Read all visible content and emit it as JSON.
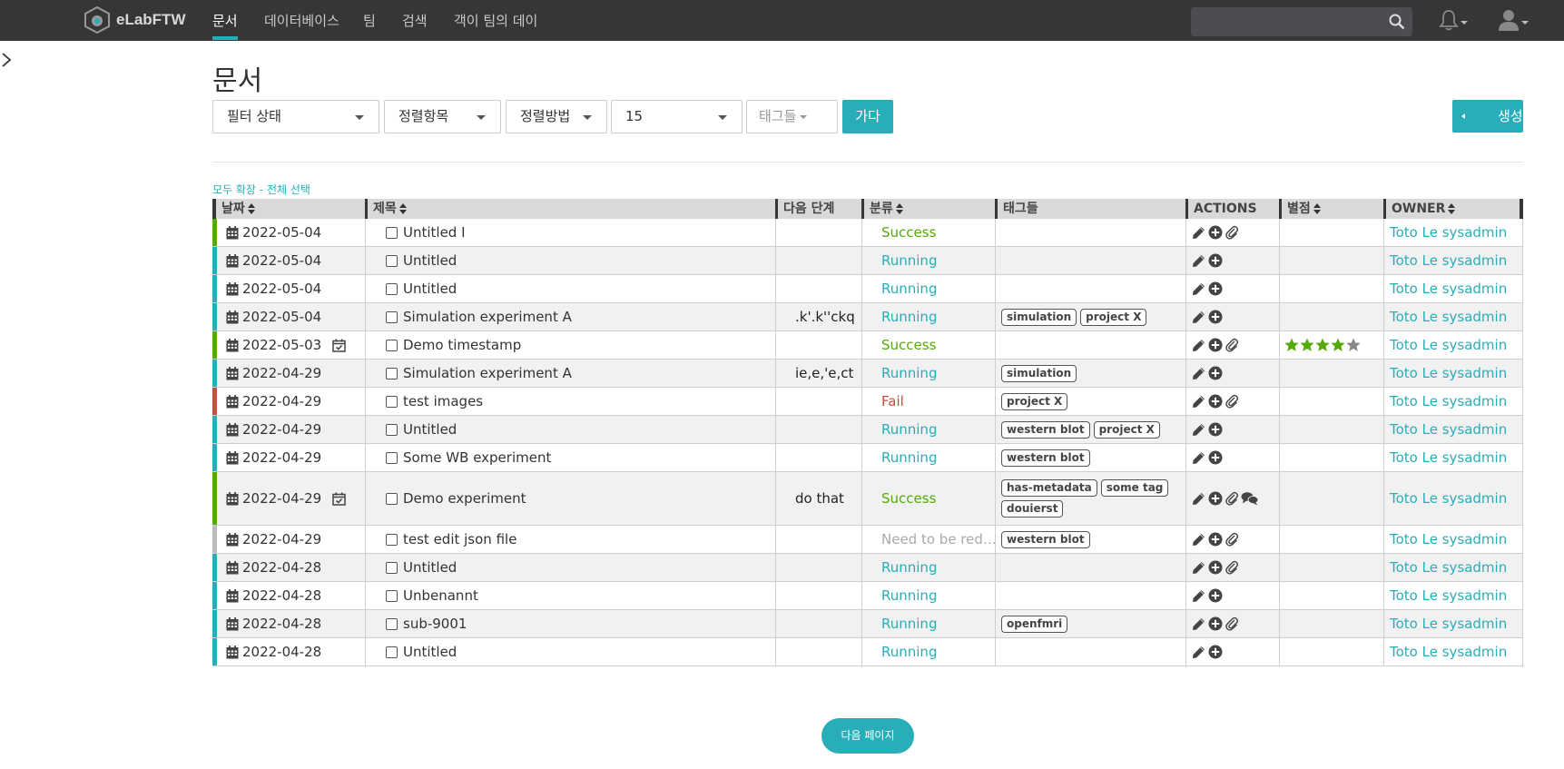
{
  "nav": {
    "brand": "eLabFTW",
    "links": [
      "문서",
      "데이터베이스",
      "팀",
      "검색",
      "객이 팀의 데이"
    ],
    "search_placeholder": ""
  },
  "page": {
    "title": "문서",
    "filters": {
      "status": "필터 상태",
      "order": "정렬항목",
      "sort": "정렬방법",
      "limit": "15",
      "tags": "태그들"
    },
    "go_label": "가다",
    "create_label": "생성",
    "expand_all": "모두 확장",
    "link_sep": " - ",
    "select_all": "전체 선택",
    "next_page": "다음 페이지"
  },
  "table": {
    "headers": {
      "date": "날짜",
      "title": "제목",
      "next_step": "다음 단계",
      "category": "분류",
      "tags": "태그들",
      "actions": "ACTIONS",
      "rating": "별점",
      "owner": "OWNER"
    },
    "rows": [
      {
        "date": "2022-05-04",
        "title": "Untitled I",
        "step": "",
        "category": "Success",
        "tags": [],
        "attach": true,
        "comment": false,
        "rating": 0,
        "ts": false,
        "owner": "Toto Le sysadmin"
      },
      {
        "date": "2022-05-04",
        "title": "Untitled",
        "step": "",
        "category": "Running",
        "tags": [],
        "attach": false,
        "comment": false,
        "rating": 0,
        "ts": false,
        "owner": "Toto Le sysadmin"
      },
      {
        "date": "2022-05-04",
        "title": "Untitled",
        "step": "",
        "category": "Running",
        "tags": [],
        "attach": false,
        "comment": false,
        "rating": 0,
        "ts": false,
        "owner": "Toto Le sysadmin"
      },
      {
        "date": "2022-05-04",
        "title": "Simulation experiment A",
        "step": ".k'.k''ckq",
        "category": "Running",
        "tags": [
          "simulation",
          "project X"
        ],
        "attach": false,
        "comment": false,
        "rating": 0,
        "ts": false,
        "owner": "Toto Le sysadmin"
      },
      {
        "date": "2022-05-03",
        "title": "Demo timestamp",
        "step": "",
        "category": "Success",
        "tags": [],
        "attach": true,
        "comment": false,
        "rating": 4,
        "ts": true,
        "owner": "Toto Le sysadmin"
      },
      {
        "date": "2022-04-29",
        "title": "Simulation experiment A",
        "step": "ie,e,'e,ct",
        "category": "Running",
        "tags": [
          "simulation"
        ],
        "attach": false,
        "comment": false,
        "rating": 0,
        "ts": false,
        "owner": "Toto Le sysadmin"
      },
      {
        "date": "2022-04-29",
        "title": "test images",
        "step": "",
        "category": "Fail",
        "tags": [
          "project X"
        ],
        "attach": true,
        "comment": false,
        "rating": 0,
        "ts": false,
        "owner": "Toto Le sysadmin"
      },
      {
        "date": "2022-04-29",
        "title": "Untitled",
        "step": "",
        "category": "Running",
        "tags": [
          "western blot",
          "project X"
        ],
        "attach": false,
        "comment": false,
        "rating": 0,
        "ts": false,
        "owner": "Toto Le sysadmin"
      },
      {
        "date": "2022-04-29",
        "title": "Some WB experiment",
        "step": "",
        "category": "Running",
        "tags": [
          "western blot"
        ],
        "attach": false,
        "comment": false,
        "rating": 0,
        "ts": false,
        "owner": "Toto Le sysadmin"
      },
      {
        "date": "2022-04-29",
        "title": "Demo experiment",
        "step": "do that",
        "category": "Success",
        "tags": [
          "has-metadata",
          "some tag",
          "douierst"
        ],
        "attach": true,
        "comment": true,
        "rating": 0,
        "ts": true,
        "owner": "Toto Le sysadmin"
      },
      {
        "date": "2022-04-29",
        "title": "test edit json file",
        "step": "",
        "category": "Need to be red…",
        "tags": [
          "western blot"
        ],
        "attach": true,
        "comment": false,
        "rating": 0,
        "ts": false,
        "owner": "Toto Le sysadmin"
      },
      {
        "date": "2022-04-28",
        "title": "Untitled",
        "step": "",
        "category": "Running",
        "tags": [],
        "attach": true,
        "comment": false,
        "rating": 0,
        "ts": false,
        "owner": "Toto Le sysadmin"
      },
      {
        "date": "2022-04-28",
        "title": "Unbenannt",
        "step": "",
        "category": "Running",
        "tags": [],
        "attach": false,
        "comment": false,
        "rating": 0,
        "ts": false,
        "owner": "Toto Le sysadmin"
      },
      {
        "date": "2022-04-28",
        "title": "sub-9001",
        "step": "",
        "category": "Running",
        "tags": [
          "openfmri"
        ],
        "attach": true,
        "comment": false,
        "rating": 0,
        "ts": false,
        "owner": "Toto Le sysadmin"
      },
      {
        "date": "2022-04-28",
        "title": "Untitled",
        "step": "",
        "category": "Running",
        "tags": [],
        "attach": false,
        "comment": false,
        "rating": 0,
        "ts": false,
        "owner": "Toto Le sysadmin"
      }
    ]
  },
  "colors": {
    "navbar": "#343638",
    "accent": "#29aeb9",
    "success": "#54aa08",
    "running": "#29aeb9",
    "fail": "#c24f3d",
    "other": "#bbbbbb"
  }
}
